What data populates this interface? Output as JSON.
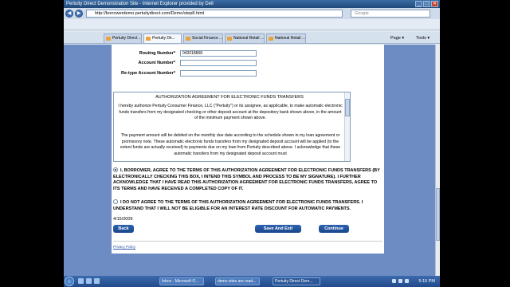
{
  "window": {
    "title": "Pertuity Direct Demonstration Site - Internet Explorer provided by Dell",
    "min": "_",
    "max": "□",
    "close": "✕"
  },
  "address": {
    "url": "http://borrowerdemo.pertuitydirect.com/Demo/step8.html",
    "search_placeholder": "Google"
  },
  "tabs": [
    {
      "label": "Pertuity Direct ..."
    },
    {
      "label": "Pertuity Dir..."
    },
    {
      "label": "Social Finance ..."
    },
    {
      "label": "National Retail ..."
    },
    {
      "label": "National Retail ..."
    }
  ],
  "toolbar": {
    "page_label": "Page ▾",
    "tools_label": "Tools ▾"
  },
  "form": {
    "routing_label": "Routing Number*",
    "routing_value": "043018868",
    "account_label": "Account Number*",
    "account_value": "",
    "retype_label": "Re-type Account Number*",
    "retype_value": ""
  },
  "agreement": {
    "title": "AUTHORIZATION AGREEMENT FOR ELECTRONIC FUNDS TRANSFERS",
    "para1": "I hereby authorize Pertuity Consumer Finance, LLC (\"Pertuity\") or its assignee, as applicable, to make automatic electronic funds transfers from my designated checking or other deposit account at the depository bank shown above, in the amount of the minimum payment shown above.",
    "para2": "The payment amount will be debited on the monthly due date according to the schedule shown in my loan agreement or promissory note. These automatic electronic funds transfers from my designated deposit account will be applied (to the extent funds are actually received) to payments due on my loan from Pertuity described above. I acknowledge that these automatic transfers from my designated deposit account must"
  },
  "options": {
    "agree": "I, BORROWER, AGREE TO THE TERMS OF THIS AUTHORIZATION AGREEMENT FOR ELECTRONIC FUNDS TRANSFERS (BY ELECTRONICALLY CHECKING THIS BOX, I INTEND THIS SYMBOL AND PROCESS TO BE MY SIGNATURE). I FURTHER ACKNOWLEDGE THAT I HAVE READ THIS AUTHORIZATION AGREEMENT FOR ELECTRONIC FUNDS TRANSFERS, AGREE TO ITS TERMS AND HAVE RECEIVED A COMPLETED COPY OF IT.",
    "disagree": "I DO NOT AGREE TO THE TERMS OF THIS AUTHORIZATION AGREEMENT FOR ELECTRONIC FUNDS TRANSFERS. I UNDERSTAND THAT I WILL NOT BE ELIGIBLE FOR AN INTEREST RATE DISCOUNT FOR AUTOMATIC PAYMENTS.",
    "date": "4/15/2009"
  },
  "buttons": {
    "back": "Back",
    "save_exit": "Save And Exit",
    "continue": "Continue"
  },
  "footer": {
    "privacy": "Privacy Policy"
  },
  "taskbar": {
    "items": [
      {
        "label": "Inbox - Microsoft O..."
      },
      {
        "label": "demo sites are read..."
      },
      {
        "label": "Pertuity Direct Dem..."
      }
    ],
    "clock": "5:15 PM"
  }
}
